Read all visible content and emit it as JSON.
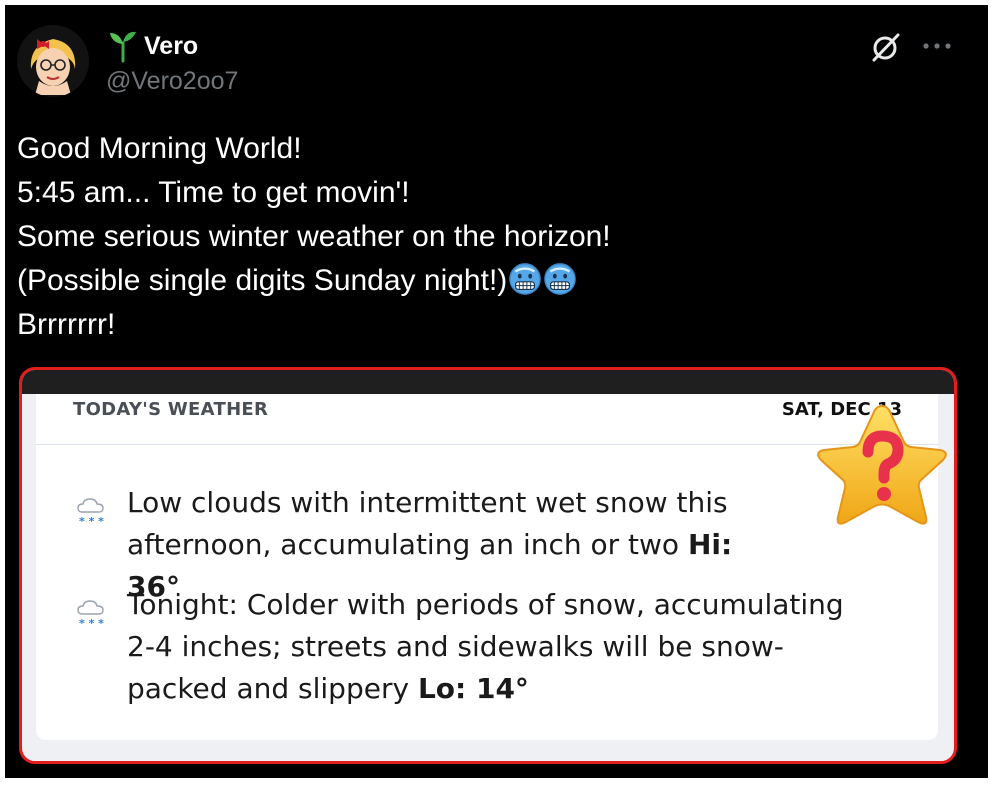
{
  "author": {
    "name": "Vero",
    "handle": "@Vero2oo7"
  },
  "tweet": {
    "lines": [
      "Good Morning World!",
      "5:45 am... Time to get movin'!",
      "Some serious winter weather on the horizon!",
      "(Possible single digits Sunday night!)",
      "Brrrrrrr!"
    ],
    "emoji": "cold-face"
  },
  "weather_card": {
    "header_left": "TODAY'S WEATHER",
    "header_right": "SAT, DEC 13",
    "forecasts": [
      {
        "icon": "snow-cloud-icon",
        "text": "Low clouds with intermittent wet snow this afternoon, accumulating an inch or two",
        "temp_label": "Hi: 36°"
      },
      {
        "icon": "snow-cloud-icon",
        "text": "Tonight: Colder with periods of snow, accumulating 2-4 inches; streets and sidewalks will be snow-packed and slippery",
        "temp_label": "Lo: 14°"
      }
    ]
  },
  "colors": {
    "background": "#000000",
    "handle_gray": "#71767b",
    "highlight_border": "#e21d1d",
    "star_yellow": "#f7c430",
    "question_mark": "#e8324c"
  }
}
